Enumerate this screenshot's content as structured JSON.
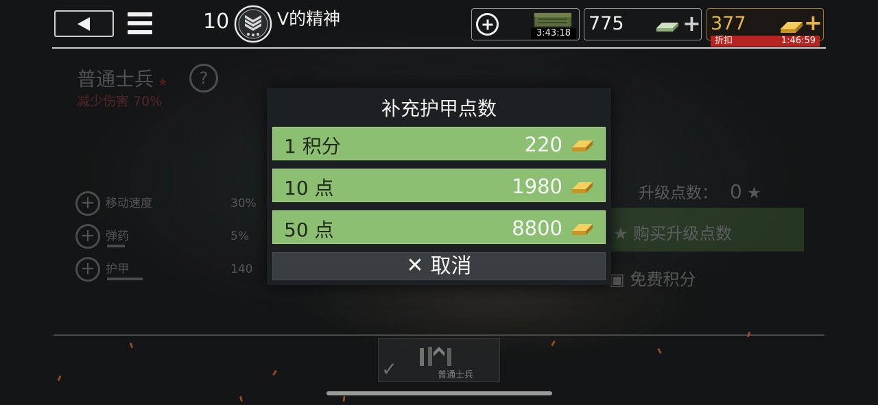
{
  "header": {
    "rank_level": "10",
    "player_name": "V的精神",
    "timer_value": "3:43:18",
    "silver_amount": "775",
    "gold_amount": "377",
    "gold_sale_tag": "折扣",
    "gold_sale_time": "1:46:59"
  },
  "background": {
    "unit_title": "普通士兵",
    "damage_text": "减少伤害 70%",
    "help_label": "?",
    "stats": [
      {
        "label": "移动速度",
        "value": "30%"
      },
      {
        "label": "弹药",
        "value": "5%"
      },
      {
        "label": "护甲",
        "value": "140"
      }
    ],
    "upgrade_points_label": "升级点数：",
    "upgrade_points_value": "0",
    "buy_points_label": "购买升级点数",
    "free_points_label": "免费积分",
    "tank_card_name": "普通士兵"
  },
  "modal": {
    "title": "补充护甲点数",
    "options": [
      {
        "label": "1 积分",
        "price": "220"
      },
      {
        "label": "10 点",
        "price": "1980"
      },
      {
        "label": "50 点",
        "price": "8800"
      }
    ],
    "cancel_label": "取消"
  },
  "colors": {
    "option_green": "#8dbf73",
    "gold": "#e7b64a",
    "sale_red": "#b52421"
  }
}
